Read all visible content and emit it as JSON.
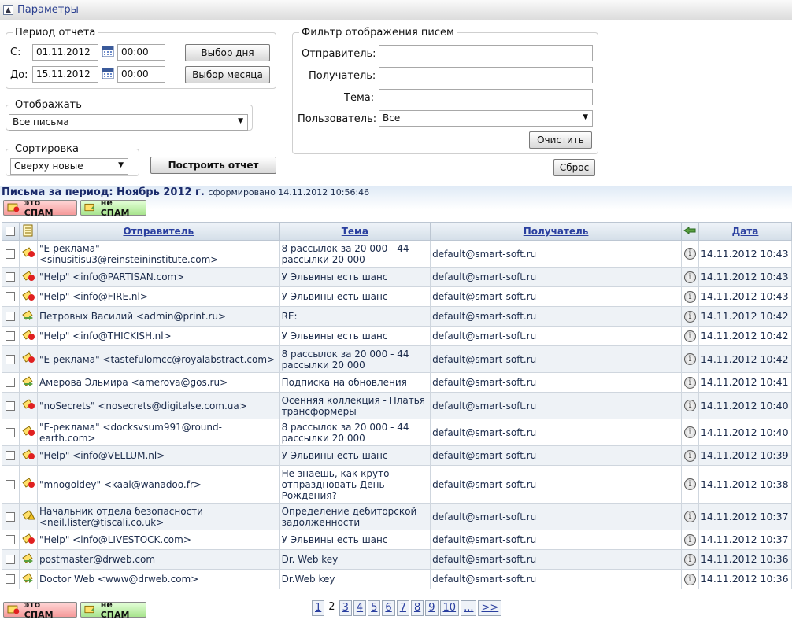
{
  "header": {
    "title": "Параметры"
  },
  "period": {
    "legend": "Период отчета",
    "from_label": "С:",
    "from_date": "01.11.2012",
    "from_time": "00:00",
    "to_label": "До:",
    "to_date": "15.11.2012",
    "to_time": "00:00",
    "day_button": "Выбор дня",
    "month_button": "Выбор месяца"
  },
  "display": {
    "legend": "Отображать",
    "value": "Все письма"
  },
  "sort": {
    "legend": "Сортировка",
    "value": "Сверху новые"
  },
  "build_button": "Построить отчет",
  "filter": {
    "legend": "Фильтр отображения писем",
    "sender_label": "Отправитель:",
    "recipient_label": "Получатель:",
    "subject_label": "Тема:",
    "user_label": "Пользователь:",
    "user_value": "Все",
    "clear_button": "Очистить"
  },
  "reset_button": "Сброс",
  "report": {
    "title": "Письма за период: Ноябрь 2012 г.",
    "generated": "сформировано 14.11.2012 10:56:46",
    "spam_button": "это СПАМ",
    "ham_button": "не СПАМ"
  },
  "table": {
    "headers": {
      "sender": "Отправитель",
      "subject": "Тема",
      "recipient": "Получатель",
      "date": "Дата"
    },
    "rows": [
      {
        "type": "spam",
        "sender": "\"E-реклама\" <sinusitisu3@reinsteininstitute.com>",
        "subject": "8 рассылок за 20 000 - 44 рассылки 20 000",
        "recipient": "default@smart-soft.ru",
        "date": "14.11.2012 10:43"
      },
      {
        "type": "spam",
        "sender": "\"Help\" <info@PARTISAN.com>",
        "subject": "У Эльвины есть шанс",
        "recipient": "default@smart-soft.ru",
        "date": "14.11.2012 10:43"
      },
      {
        "type": "spam",
        "sender": "\"Help\" <info@FIRE.nl>",
        "subject": "У Эльвины есть шанс",
        "recipient": "default@smart-soft.ru",
        "date": "14.11.2012 10:43"
      },
      {
        "type": "ham",
        "sender": "Петровых Василий <admin@print.ru>",
        "subject": "RE:",
        "recipient": "default@smart-soft.ru",
        "date": "14.11.2012 10:42"
      },
      {
        "type": "spam",
        "sender": "\"Help\" <info@THICKISH.nl>",
        "subject": "У Эльвины есть шанс",
        "recipient": "default@smart-soft.ru",
        "date": "14.11.2012 10:42"
      },
      {
        "type": "spam",
        "sender": "\"E-реклама\" <tastefulomcc@royalabstract.com>",
        "subject": "8 рассылок за 20 000 - 44 рассылки 20 000",
        "recipient": "default@smart-soft.ru",
        "date": "14.11.2012 10:42"
      },
      {
        "type": "ham",
        "sender": "Амерова Эльмира <amerova@gos.ru>",
        "subject": "Подписка на обновления",
        "recipient": "default@smart-soft.ru",
        "date": "14.11.2012 10:41"
      },
      {
        "type": "spam",
        "sender": "\"noSecrets\" <nosecrets@digitalse.com.ua>",
        "subject": "Осенняя коллекция - Платья трансформеры",
        "recipient": "default@smart-soft.ru",
        "date": "14.11.2012 10:40"
      },
      {
        "type": "spam",
        "sender": "\"E-реклама\" <docksvsum991@round-earth.com>",
        "subject": "8 рассылок за 20 000 - 44 рассылки 20 000",
        "recipient": "default@smart-soft.ru",
        "date": "14.11.2012 10:40"
      },
      {
        "type": "spam",
        "sender": "\"Help\" <info@VELLUM.nl>",
        "subject": "У Эльвины есть шанс",
        "recipient": "default@smart-soft.ru",
        "date": "14.11.2012 10:39"
      },
      {
        "type": "spam",
        "sender": "\"mnogoidey\" <kaal@wanadoo.fr>",
        "subject": "Не знаешь, как круто отпраздновать День Рождения?",
        "recipient": "default@smart-soft.ru",
        "date": "14.11.2012 10:38"
      },
      {
        "type": "warn",
        "sender": "Начальник отдела безопасности <neil.lister@tiscali.co.uk>",
        "subject": "Определение дебиторской задолженности",
        "recipient": "default@smart-soft.ru",
        "date": "14.11.2012 10:37"
      },
      {
        "type": "spam",
        "sender": "\"Help\" <info@LIVESTOCK.com>",
        "subject": "У Эльвины есть шанс",
        "recipient": "default@smart-soft.ru",
        "date": "14.11.2012 10:37"
      },
      {
        "type": "ham",
        "sender": "postmaster@drweb.com",
        "subject": "Dr. Web key",
        "recipient": "default@smart-soft.ru",
        "date": "14.11.2012 10:36"
      },
      {
        "type": "ham",
        "sender": "Doctor Web <www@drweb.com>",
        "subject": "Dr.Web key",
        "recipient": "default@smart-soft.ru",
        "date": "14.11.2012 10:36"
      }
    ]
  },
  "pager": {
    "pages": [
      "1",
      "2",
      "3",
      "4",
      "5",
      "6",
      "7",
      "8",
      "9",
      "10",
      "...",
      ">>"
    ],
    "current": "2"
  },
  "colors": {
    "spam_icon": "#e02020",
    "ham_icon": "#5aa040",
    "header_text": "#2a3f9f"
  }
}
